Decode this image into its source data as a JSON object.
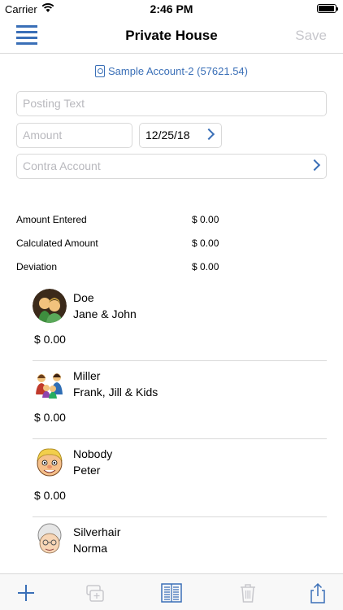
{
  "status_bar": {
    "carrier": "Carrier",
    "time": "2:46 PM"
  },
  "nav": {
    "title": "Private House",
    "save_label": "Save"
  },
  "account": {
    "label": "Sample Account-2 (57621.54)"
  },
  "form": {
    "posting_placeholder": "Posting Text",
    "amount_placeholder": "Amount",
    "date_value": "12/25/18",
    "contra_placeholder": "Contra Account"
  },
  "summary": [
    {
      "label": "Amount Entered",
      "value": "$ 0.00"
    },
    {
      "label": "Calculated Amount",
      "value": "$ 0.00"
    },
    {
      "label": "Deviation",
      "value": "$ 0.00"
    }
  ],
  "people": [
    {
      "last": "Doe",
      "first": "Jane & John",
      "amount": "$ 0.00",
      "avatar": "couple-avatar"
    },
    {
      "last": "Miller",
      "first": "Frank, Jill & Kids",
      "amount": "$ 0.00",
      "avatar": "family-avatar"
    },
    {
      "last": "Nobody",
      "first": "Peter",
      "amount": "$ 0.00",
      "avatar": "boy-avatar"
    },
    {
      "last": "Silverhair",
      "first": "Norma",
      "amount": "",
      "avatar": "grandma-avatar"
    }
  ],
  "colors": {
    "accent": "#3a6fb7",
    "disabled": "#c7c7cc",
    "separator": "#d9d9d9"
  },
  "toolbar_icons": [
    "add-icon",
    "duplicate-icon",
    "list-icon",
    "trash-icon",
    "share-icon"
  ]
}
